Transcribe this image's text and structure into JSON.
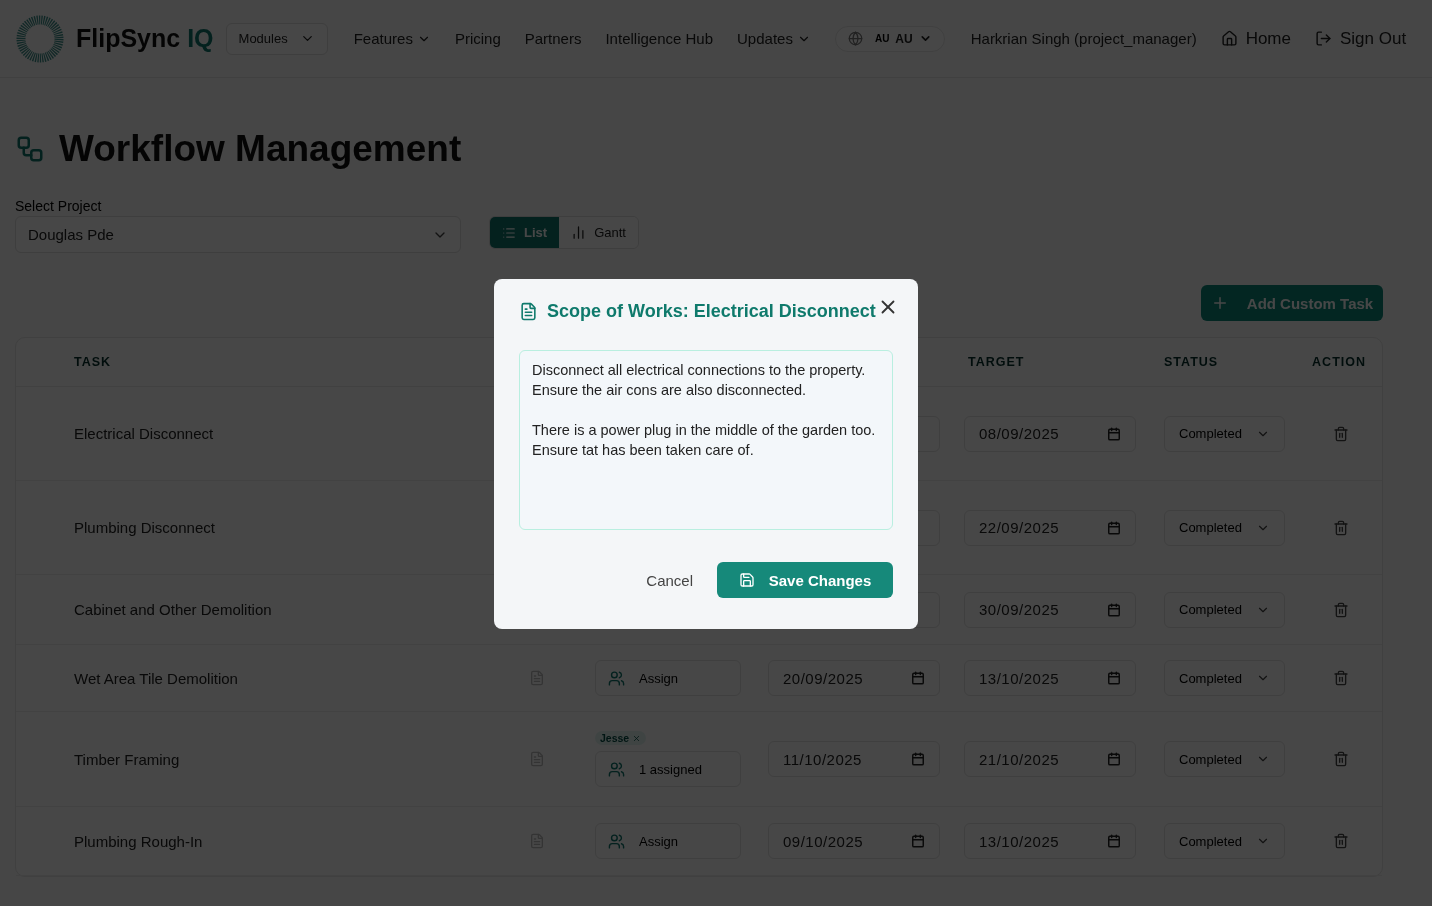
{
  "header": {
    "brand": {
      "name": "FlipSync",
      "suffix": "IQ"
    },
    "modules": "Modules",
    "nav": [
      {
        "label": "Features",
        "dropdown": true
      },
      {
        "label": "Pricing",
        "dropdown": false
      },
      {
        "label": "Partners",
        "dropdown": false
      },
      {
        "label": "Intelligence Hub",
        "dropdown": false
      },
      {
        "label": "Updates",
        "dropdown": true
      }
    ],
    "locale": {
      "flag": "AU",
      "code": "AU"
    },
    "user": "Harkrian Singh (project_manager)",
    "links": [
      {
        "label": "Home",
        "kind": "home"
      },
      {
        "label": "Sign Out",
        "kind": "signout"
      }
    ]
  },
  "page": {
    "title": "Workflow Management",
    "project": {
      "label": "Select Project",
      "value": "Douglas Pde"
    },
    "views": [
      {
        "label": "List",
        "kind": "list",
        "selected": true
      },
      {
        "label": "Gantt",
        "kind": "gantt",
        "selected": false
      }
    ],
    "add_button": "Add Custom Task"
  },
  "table": {
    "headers": {
      "task": "TASK",
      "target": "TARGET",
      "status": "STATUS",
      "action": "ACTION"
    },
    "rows": [
      {
        "task": "Electrical Disconnect",
        "target": "08/09/2025",
        "status": "Completed"
      },
      {
        "task": "Plumbing Disconnect",
        "target": "22/09/2025",
        "status": "Completed"
      },
      {
        "task": "Cabinet and Other Demolition",
        "target": "30/09/2025",
        "status": "Completed"
      },
      {
        "task": "Wet Area Tile Demolition",
        "assign": "Assign",
        "start": "20/09/2025",
        "target": "13/10/2025",
        "status": "Completed"
      },
      {
        "task": "Timber Framing",
        "assignees": [
          "Jesse"
        ],
        "assign": "1 assigned",
        "start": "11/10/2025",
        "target": "21/10/2025",
        "status": "Completed"
      },
      {
        "task": "Plumbing Rough-In",
        "assign": "Assign",
        "start": "09/10/2025",
        "target": "13/10/2025",
        "status": "Completed"
      }
    ]
  },
  "modal": {
    "title": "Scope of Works: Electrical Disconnect",
    "text": "Disconnect all electrical connections to the property.\nEnsure the air cons are also disconnected.\n\nThere is a power plug in the middle of the garden too. Ensure tat has been taken care of.",
    "cancel": "Cancel",
    "save": "Save Changes"
  }
}
